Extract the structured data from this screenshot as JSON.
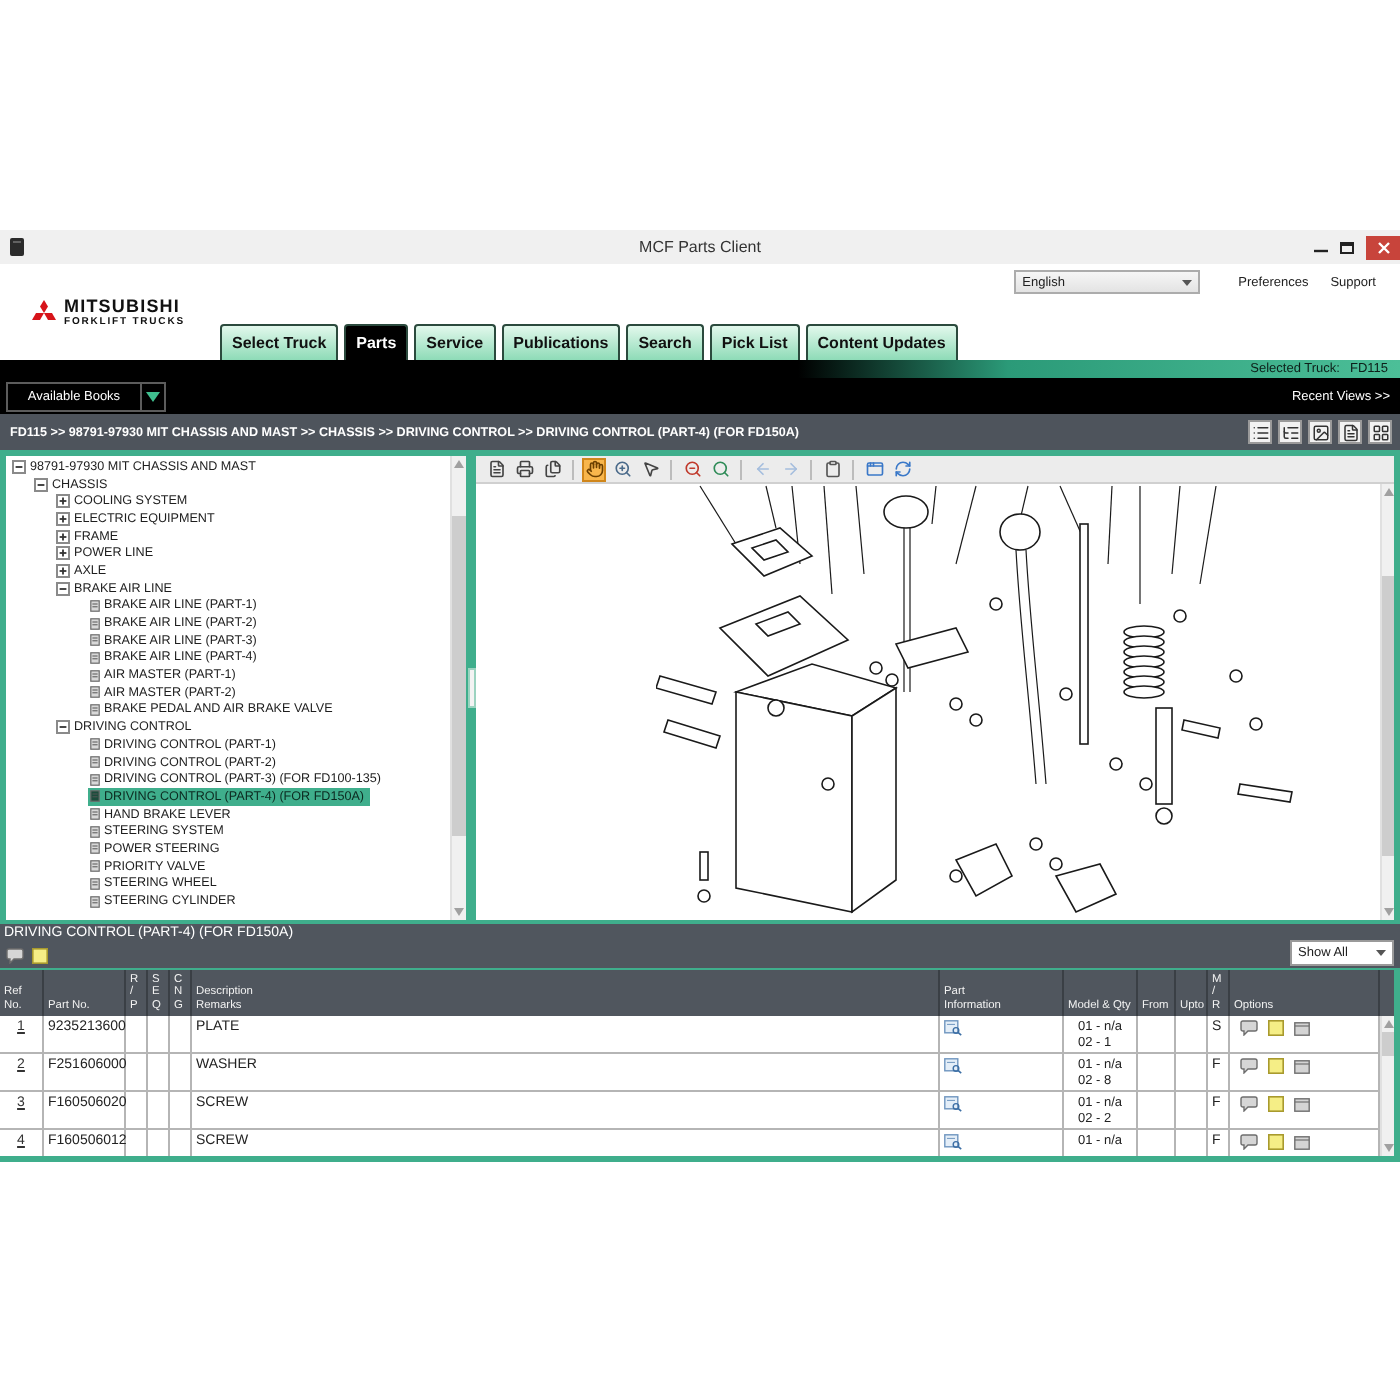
{
  "window": {
    "title": "MCF Parts Client"
  },
  "header": {
    "brand": {
      "name": "MITSUBISHI",
      "tagline": "FORKLIFT TRUCKS"
    },
    "language": "English",
    "links": [
      "Preferences",
      "Support"
    ]
  },
  "tabs": [
    {
      "label": "Select Truck",
      "selected": false
    },
    {
      "label": "Parts",
      "selected": true
    },
    {
      "label": "Service",
      "selected": false
    },
    {
      "label": "Publications",
      "selected": false
    },
    {
      "label": "Search",
      "selected": false
    },
    {
      "label": "Pick List",
      "selected": false
    },
    {
      "label": "Content Updates",
      "selected": false
    }
  ],
  "truck_bar": {
    "label": "Selected Truck:",
    "value": "FD115"
  },
  "books_bar": {
    "book_select": "Available Books",
    "recent_views": "Recent Views >>"
  },
  "breadcrumb": "FD115 >> 98791-97930 MIT CHASSIS AND MAST >> CHASSIS >> DRIVING CONTROL >> DRIVING CONTROL (PART-4) (FOR FD150A)",
  "tree": [
    {
      "label": "98791-97930 MIT CHASSIS AND MAST",
      "kind": "folder",
      "expanded": true,
      "selected": false,
      "children": [
        {
          "label": "CHASSIS",
          "kind": "folder",
          "expanded": true,
          "selected": false,
          "children": [
            {
              "label": "COOLING SYSTEM",
              "kind": "folder",
              "expanded": false,
              "selected": false
            },
            {
              "label": "ELECTRIC EQUIPMENT",
              "kind": "folder",
              "expanded": false,
              "selected": false
            },
            {
              "label": "FRAME",
              "kind": "folder",
              "expanded": false,
              "selected": false
            },
            {
              "label": "POWER LINE",
              "kind": "folder",
              "expanded": false,
              "selected": false
            },
            {
              "label": "AXLE",
              "kind": "folder",
              "expanded": false,
              "selected": false
            },
            {
              "label": "BRAKE AIR LINE",
              "kind": "folder",
              "expanded": true,
              "selected": false,
              "children": [
                {
                  "label": "BRAKE AIR LINE (PART-1)",
                  "kind": "page",
                  "selected": false
                },
                {
                  "label": "BRAKE AIR LINE (PART-2)",
                  "kind": "page",
                  "selected": false
                },
                {
                  "label": "BRAKE AIR LINE (PART-3)",
                  "kind": "page",
                  "selected": false
                },
                {
                  "label": "BRAKE AIR LINE (PART-4)",
                  "kind": "page",
                  "selected": false
                },
                {
                  "label": "AIR MASTER (PART-1)",
                  "kind": "page",
                  "selected": false
                },
                {
                  "label": "AIR MASTER (PART-2)",
                  "kind": "page",
                  "selected": false
                },
                {
                  "label": "BRAKE PEDAL AND AIR BRAKE VALVE",
                  "kind": "page",
                  "selected": false
                }
              ]
            },
            {
              "label": "DRIVING CONTROL",
              "kind": "folder",
              "expanded": true,
              "selected": false,
              "children": [
                {
                  "label": "DRIVING CONTROL (PART-1)",
                  "kind": "page",
                  "selected": false
                },
                {
                  "label": "DRIVING CONTROL (PART-2)",
                  "kind": "page",
                  "selected": false
                },
                {
                  "label": "DRIVING CONTROL (PART-3) (FOR FD100-135)",
                  "kind": "page",
                  "selected": false
                },
                {
                  "label": "DRIVING CONTROL (PART-4) (FOR FD150A)",
                  "kind": "page",
                  "selected": true
                },
                {
                  "label": "HAND BRAKE LEVER",
                  "kind": "page",
                  "selected": false
                },
                {
                  "label": "STEERING SYSTEM",
                  "kind": "page",
                  "selected": false
                },
                {
                  "label": "POWER STEERING",
                  "kind": "page",
                  "selected": false
                },
                {
                  "label": "PRIORITY VALVE",
                  "kind": "page",
                  "selected": false
                },
                {
                  "label": "STEERING WHEEL",
                  "kind": "page",
                  "selected": false
                },
                {
                  "label": "STEERING CYLINDER",
                  "kind": "page",
                  "selected": false
                }
              ]
            }
          ]
        }
      ]
    }
  ],
  "diagram_toolbar": [
    {
      "kind": "document",
      "selected": false,
      "disabled": false
    },
    {
      "kind": "print",
      "selected": false,
      "disabled": false
    },
    {
      "kind": "preview",
      "selected": false,
      "disabled": false
    },
    {
      "kind": "hand",
      "selected": true,
      "disabled": false
    },
    {
      "kind": "zoom",
      "selected": false,
      "disabled": false
    },
    {
      "kind": "pointer",
      "selected": false,
      "disabled": false
    },
    {
      "kind": "zoomout",
      "selected": false,
      "disabled": false
    },
    {
      "kind": "fit",
      "selected": false,
      "disabled": false
    },
    {
      "kind": "back",
      "selected": false,
      "disabled": true
    },
    {
      "kind": "forward",
      "selected": false,
      "disabled": true
    },
    {
      "kind": "clipboard",
      "selected": false,
      "disabled": false
    },
    {
      "kind": "window",
      "selected": false,
      "disabled": false
    },
    {
      "kind": "refresh",
      "selected": false,
      "disabled": false
    }
  ],
  "parts_list": {
    "title": "DRIVING CONTROL (PART-4) (FOR FD150A)",
    "filter": "Show All",
    "columns": [
      "Ref\nNo.",
      "Part No.",
      "R\n/\nP",
      "S\nE\nQ",
      "C\nN\nG",
      "Description\nRemarks",
      "Part\nInformation",
      "Model & Qty",
      "From",
      "Upto",
      "M\n/\nR",
      "Options"
    ],
    "rows": [
      {
        "ref": "1",
        "part_no": "9235213600",
        "description": "PLATE",
        "model_qty": [
          "01 - n/a",
          "02 - 1"
        ],
        "m_r": "S"
      },
      {
        "ref": "2",
        "part_no": "F251606000",
        "description": "WASHER",
        "model_qty": [
          "01 - n/a",
          "02 - 8"
        ],
        "m_r": "F"
      },
      {
        "ref": "3",
        "part_no": "F160506020",
        "description": "SCREW",
        "model_qty": [
          "01 - n/a",
          "02 - 2"
        ],
        "m_r": "F"
      },
      {
        "ref": "4",
        "part_no": "F160506012",
        "description": "SCREW",
        "model_qty": [
          "01 - n/a"
        ],
        "m_r": "F"
      }
    ]
  }
}
